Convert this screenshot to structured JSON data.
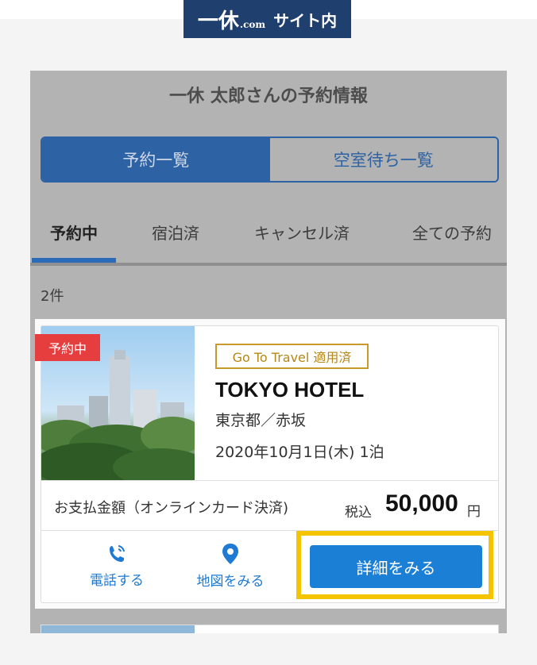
{
  "brand": {
    "logo_main": "一休",
    "logo_sub": ".com",
    "suffix": "サイト内"
  },
  "panel": {
    "title": "一休 太郎さんの予約情報",
    "segments": [
      "予約一覧",
      "空室待ち一覧"
    ],
    "tabs": [
      "予約中",
      "宿泊済",
      "キャンセル済",
      "全ての予約"
    ],
    "count": "2件"
  },
  "reservation": {
    "status_badge": "予約中",
    "campaign_badge": "Go To Travel 適用済",
    "hotel_name": "TOKYO HOTEL",
    "location": "東京都／赤坂",
    "date": "2020年10月1日(木)  1泊",
    "payment_label": "お支払金額（オンラインカード決済)",
    "tax_label": "税込",
    "amount": "50,000",
    "currency": "円",
    "actions": {
      "call": "電話する",
      "map": "地図をみる",
      "detail": "詳細をみる"
    }
  },
  "colors": {
    "brand": "#1f3f6e",
    "accent_blue": "#1c7fd6",
    "highlight": "#f5c400",
    "badge_red": "#e63e3e",
    "campaign_gold": "#c89a2c"
  }
}
